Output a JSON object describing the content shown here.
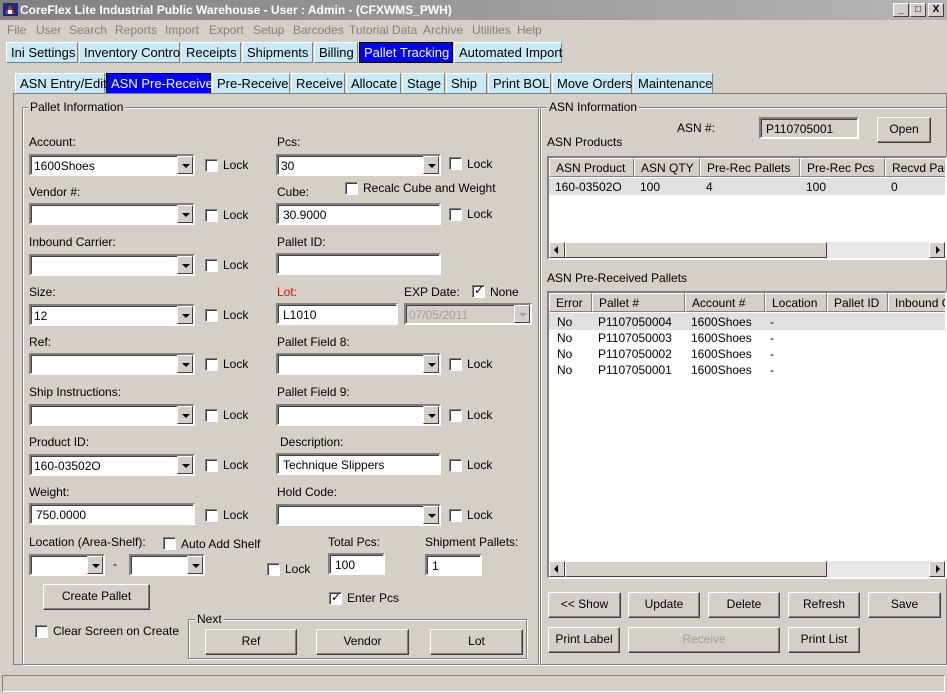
{
  "window": {
    "title": "CoreFlex Lite Industrial Public Warehouse - User : Admin - (CFXWMS_PWH)",
    "min_label": "_",
    "max_label": "□",
    "close_label": "X"
  },
  "menu": [
    "File",
    "User",
    "Search",
    "Reports",
    "Import",
    "Export",
    "Setup",
    "Barcodes",
    "Tutorial Data",
    "Archive",
    "Utilities",
    "Help"
  ],
  "main_tabs": [
    "Ini Settings",
    "Inventory Control",
    "Receipts",
    "Shipments",
    "Billing",
    "Pallet Tracking",
    "Automated Import"
  ],
  "main_tab_active": "Pallet Tracking",
  "sub_tabs": [
    "ASN Entry/Edit",
    "ASN Pre-Receive",
    "Pre-Receive",
    "Receive",
    "Allocate",
    "Stage",
    "Ship",
    "Print BOL",
    "Move Orders",
    "Maintenance"
  ],
  "sub_tab_active": "ASN Pre-Receive",
  "pallet_info": {
    "group_label": "Pallet Information",
    "lock_label": "Lock",
    "account": {
      "label": "Account:",
      "value": "1600Shoes"
    },
    "pcs": {
      "label": "Pcs:",
      "value": "30"
    },
    "vendor": {
      "label": "Vendor #:",
      "value": ""
    },
    "cube": {
      "label": "Cube:",
      "value": "30.9000"
    },
    "recalc_label": "Recalc Cube and Weight",
    "inbound_carrier": {
      "label": "Inbound Carrier:",
      "value": ""
    },
    "pallet_id": {
      "label": "Pallet ID:",
      "value": ""
    },
    "size": {
      "label": "Size:",
      "value": "12"
    },
    "lot": {
      "label": "Lot:",
      "value": "L1010"
    },
    "exp_date": {
      "label": "EXP Date:",
      "value": "07/05/2011",
      "none_label": "None"
    },
    "ref": {
      "label": "Ref:",
      "value": ""
    },
    "pallet_field_8": {
      "label": "Pallet Field 8:",
      "value": ""
    },
    "ship_instructions": {
      "label": "Ship Instructions:",
      "value": ""
    },
    "pallet_field_9": {
      "label": "Pallet Field 9:",
      "value": ""
    },
    "product_id": {
      "label": "Product ID:",
      "value": "160-03502O"
    },
    "description": {
      "label": "Description:",
      "value": "Technique Slippers"
    },
    "weight": {
      "label": "Weight:",
      "value": "750.0000"
    },
    "hold_code": {
      "label": "Hold Code:",
      "value": ""
    },
    "location": {
      "label": "Location (Area-Shelf):",
      "dash": "-"
    },
    "auto_add_shelf": "Auto Add Shelf",
    "total_pcs": {
      "label": "Total Pcs:",
      "value": "100"
    },
    "shipment_pallets": {
      "label": "Shipment Pallets:",
      "value": "1"
    },
    "create_pallet": "Create Pallet",
    "enter_pcs": "Enter Pcs",
    "clear_screen": "Clear Screen on Create",
    "next": {
      "label": "Next",
      "ref": "Ref",
      "vendor": "Vendor",
      "lot": "Lot"
    }
  },
  "asn_info": {
    "group_label": "ASN Information",
    "asn_number_label": "ASN #:",
    "asn_number": "P110705001",
    "open_label": "Open",
    "products_label": "ASN Products",
    "products_columns": [
      "ASN Product",
      "ASN QTY",
      "Pre-Rec Pallets",
      "Pre-Rec Pcs",
      "Recvd Pal"
    ],
    "products_rows": [
      [
        "160-03502O",
        "100",
        "4",
        "100",
        "0"
      ]
    ],
    "pallets_label": "ASN Pre-Received Pallets",
    "pallets_columns": [
      "Error",
      "Pallet #",
      "Account #",
      "Location",
      "Pallet ID",
      "Inbound C"
    ],
    "pallets_rows": [
      [
        "No",
        "P1107050004",
        "1600Shoes",
        "-"
      ],
      [
        "No",
        "P1107050003",
        "1600Shoes",
        "-"
      ],
      [
        "No",
        "P1107050002",
        "1600Shoes",
        "-"
      ],
      [
        "No",
        "P1107050001",
        "1600Shoes",
        "-"
      ]
    ],
    "buttons": {
      "show": "<< Show",
      "update": "Update",
      "delete": "Delete",
      "refresh": "Refresh",
      "save": "Save",
      "print_label": "Print Label",
      "receive": "Receive",
      "print_list": "Print List"
    }
  }
}
